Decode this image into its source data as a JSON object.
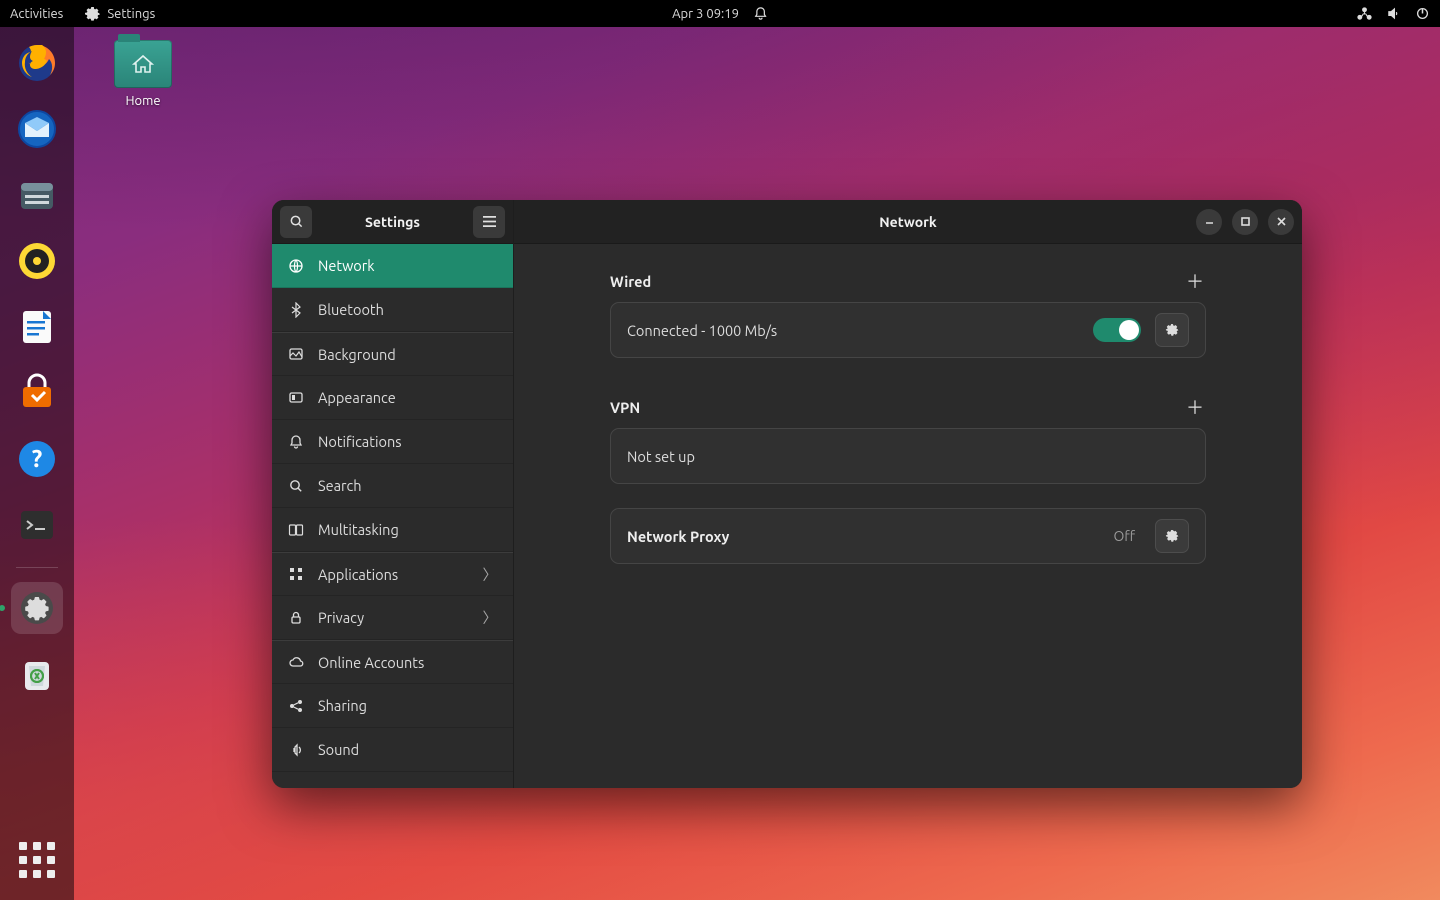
{
  "topbar": {
    "activities": "Activities",
    "app": "Settings",
    "datetime": "Apr 3  09:19"
  },
  "desktop": {
    "home": "Home"
  },
  "window": {
    "sidebar_title": "Settings",
    "content_title": "Network",
    "items": [
      {
        "label": "Network"
      },
      {
        "label": "Bluetooth"
      },
      {
        "label": "Background"
      },
      {
        "label": "Appearance"
      },
      {
        "label": "Notifications"
      },
      {
        "label": "Search"
      },
      {
        "label": "Multitasking"
      },
      {
        "label": "Applications"
      },
      {
        "label": "Privacy"
      },
      {
        "label": "Online Accounts"
      },
      {
        "label": "Sharing"
      },
      {
        "label": "Sound"
      }
    ]
  },
  "network": {
    "wired_heading": "Wired",
    "wired_status": "Connected - 1000 Mb/s",
    "vpn_heading": "VPN",
    "vpn_status": "Not set up",
    "proxy_heading": "Network Proxy",
    "proxy_status": "Off"
  }
}
